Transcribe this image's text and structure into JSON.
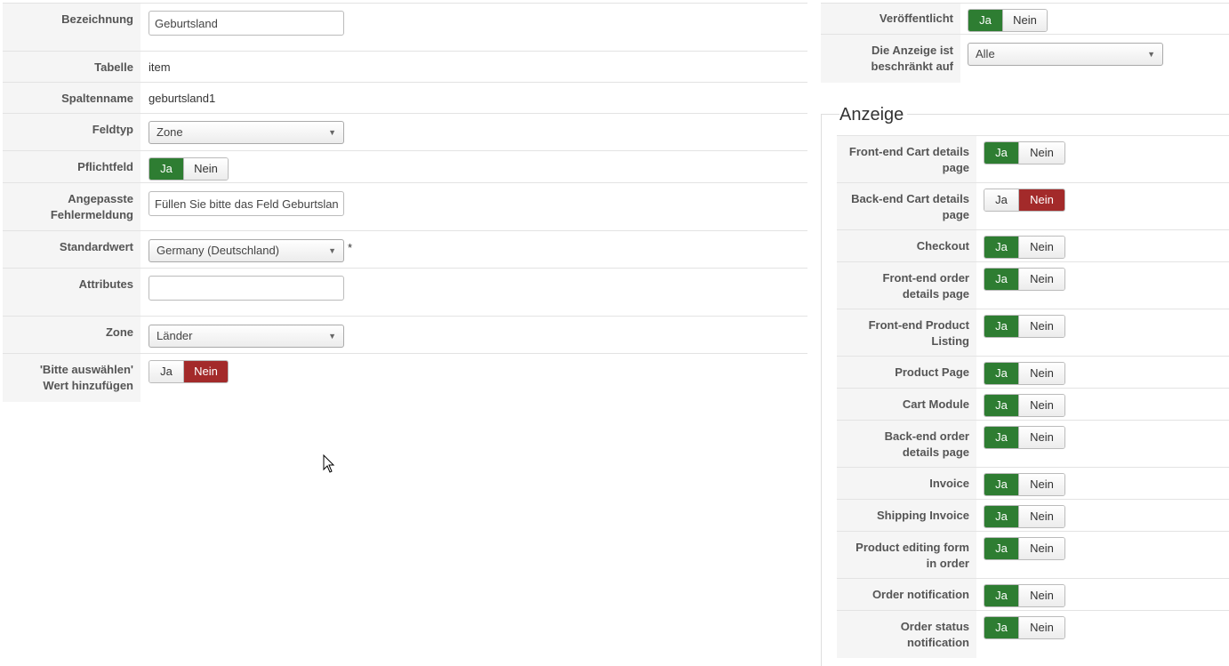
{
  "left_form": {
    "bezeichnung": {
      "label": "Bezeichnung",
      "value": "Geburtsland"
    },
    "tabelle": {
      "label": "Tabelle",
      "value": "item"
    },
    "spaltenname": {
      "label": "Spaltenname",
      "value": "geburtsland1"
    },
    "feldtyp": {
      "label": "Feldtyp",
      "value": "Zone"
    },
    "pflichtfeld": {
      "label": "Pflichtfeld",
      "yes": "Ja",
      "no": "Nein",
      "selected": "yes"
    },
    "fehlermeldung": {
      "label_line1": "Angepasste",
      "label_line2": "Fehlermeldung",
      "value": "Füllen Sie bitte das Feld Geburtsland aus"
    },
    "standardwert": {
      "label": "Standardwert",
      "value": "Germany (Deutschland)",
      "required_mark": "*"
    },
    "attributes": {
      "label": "Attributes",
      "value": ""
    },
    "zone": {
      "label": "Zone",
      "value": "Länder"
    },
    "bitte_auswaehlen": {
      "label_line1": "'Bitte auswählen'",
      "label_line2": "Wert hinzufügen",
      "yes": "Ja",
      "no": "Nein",
      "selected": "no"
    }
  },
  "right_top": {
    "veroeffentlicht": {
      "label": "Veröffentlicht",
      "yes": "Ja",
      "no": "Nein",
      "selected": "yes"
    },
    "anzeige_beschraenkt": {
      "label_line1": "Die Anzeige ist",
      "label_line2": "beschränkt auf",
      "value": "Alle"
    }
  },
  "anzeige": {
    "legend": "Anzeige",
    "rows": [
      {
        "line1": "Front-end Cart details",
        "line2": "page",
        "yes": "Ja",
        "no": "Nein",
        "selected": "yes"
      },
      {
        "line1": "Back-end Cart details",
        "line2": "page",
        "yes": "Ja",
        "no": "Nein",
        "selected": "no"
      },
      {
        "line1": "Checkout",
        "line2": "",
        "yes": "Ja",
        "no": "Nein",
        "selected": "yes"
      },
      {
        "line1": "Front-end order",
        "line2": "details page",
        "yes": "Ja",
        "no": "Nein",
        "selected": "yes"
      },
      {
        "line1": "Front-end Product",
        "line2": "Listing",
        "yes": "Ja",
        "no": "Nein",
        "selected": "yes"
      },
      {
        "line1": "Product Page",
        "line2": "",
        "yes": "Ja",
        "no": "Nein",
        "selected": "yes"
      },
      {
        "line1": "Cart Module",
        "line2": "",
        "yes": "Ja",
        "no": "Nein",
        "selected": "yes"
      },
      {
        "line1": "Back-end order",
        "line2": "details page",
        "yes": "Ja",
        "no": "Nein",
        "selected": "yes"
      },
      {
        "line1": "Invoice",
        "line2": "",
        "yes": "Ja",
        "no": "Nein",
        "selected": "yes"
      },
      {
        "line1": "Shipping Invoice",
        "line2": "",
        "yes": "Ja",
        "no": "Nein",
        "selected": "yes"
      },
      {
        "line1": "Product editing form",
        "line2": "in order",
        "yes": "Ja",
        "no": "Nein",
        "selected": "yes"
      },
      {
        "line1": "Order notification",
        "line2": "",
        "yes": "Ja",
        "no": "Nein",
        "selected": "yes"
      },
      {
        "line1": "Order status",
        "line2": "notification",
        "yes": "Ja",
        "no": "Nein",
        "selected": "yes"
      }
    ]
  },
  "colors": {
    "yes_active": "#2e7d32",
    "no_active": "#a32a2a",
    "label_bg": "#f5f5f5"
  },
  "icons": {
    "cursor": "mouse-pointer-icon",
    "dropdown": "chevron-down-icon"
  }
}
